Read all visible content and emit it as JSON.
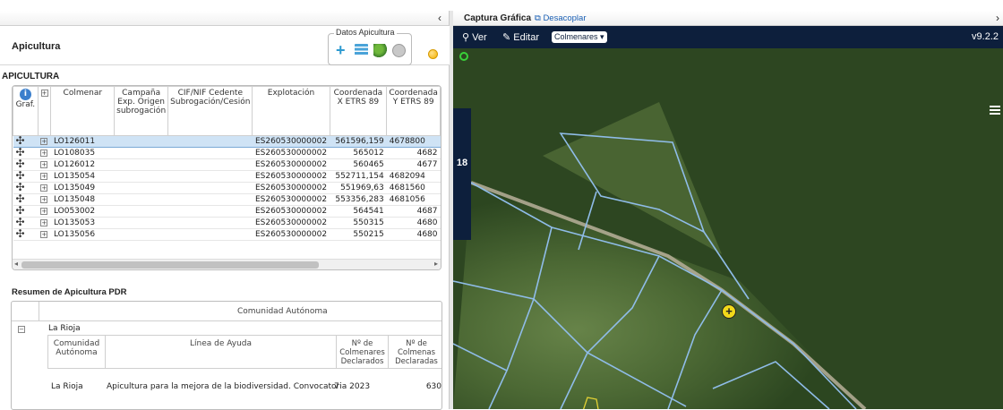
{
  "left_panel": {
    "collapse_icon": "chevron-left-icon",
    "header_title": "Apicultura",
    "datos_legend": "Datos Apicultura",
    "section_title": "APICULTURA",
    "columns": [
      "Graf.",
      "Colmenar",
      "Campaña Exp. Origen subrogación",
      "CIF/NIF Cedente Subrogación/Cesión",
      "Explotación",
      "Coordenada X ETRS 89",
      "Coordenada Y ETRS 89"
    ],
    "rows": [
      {
        "colmenar": "LO126011",
        "explotacion": "ES260530000002",
        "x": "561596,159",
        "y": "4678800"
      },
      {
        "colmenar": "LO108035",
        "explotacion": "ES260530000002",
        "x": "565012",
        "y": "4682"
      },
      {
        "colmenar": "LO126012",
        "explotacion": "ES260530000002",
        "x": "560465",
        "y": "4677"
      },
      {
        "colmenar": "LO135054",
        "explotacion": "ES260530000002",
        "x": "552711,154",
        "y": "4682094"
      },
      {
        "colmenar": "LO135049",
        "explotacion": "ES260530000002",
        "x": "551969,63",
        "y": "4681560"
      },
      {
        "colmenar": "LO135048",
        "explotacion": "ES260530000002",
        "x": "553356,283",
        "y": "4681056"
      },
      {
        "colmenar": "LO053002",
        "explotacion": "ES260530000002",
        "x": "564541",
        "y": "4687"
      },
      {
        "colmenar": "LO135053",
        "explotacion": "ES260530000002",
        "x": "550315",
        "y": "4680"
      },
      {
        "colmenar": "LO135056",
        "explotacion": "ES260530000002",
        "x": "550215",
        "y": "4680"
      }
    ],
    "resumen_title": "Resumen de Apicultura PDR",
    "summary": {
      "group_header": "Comunidad Autónoma",
      "group_value": "La Rioja",
      "col_comunidad": "Comunidad Autónoma",
      "col_linea": "Línea de Ayuda",
      "col_num_colmenares": "Nº de Colmenares Declarados",
      "col_num_colmenas": "Nº de Colmenas Declaradas",
      "row_comunidad": "La Rioja",
      "row_linea": "Apicultura para la mejora de la biodiversidad. Convocatoria 2023",
      "row_colmenares": "7",
      "row_colmenas": "630"
    }
  },
  "right_panel": {
    "title": "Captura Gráfica",
    "desacoplar": "Desacoplar",
    "ver": "Ver",
    "editar": "Editar",
    "layer_select": "Colmenares",
    "version": "v9.2.2",
    "zoom_level": "18"
  }
}
